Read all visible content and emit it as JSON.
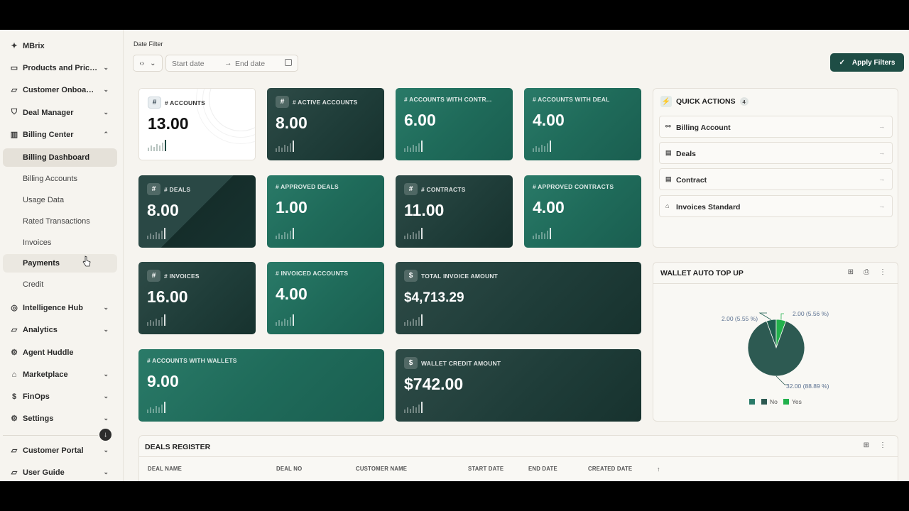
{
  "app": {
    "name": "MBrix"
  },
  "sidebar": {
    "items": [
      {
        "label": "MBrix",
        "icon": "sparkle-icon"
      },
      {
        "label": "Products and Pricing",
        "icon": "box-icon"
      },
      {
        "label": "Customer Onboarding",
        "icon": "folder-icon"
      },
      {
        "label": "Deal Manager",
        "icon": "handshake-icon"
      },
      {
        "label": "Billing Center",
        "icon": "chart-icon"
      },
      {
        "label": "Intelligence Hub",
        "icon": "globe-icon"
      },
      {
        "label": "Analytics",
        "icon": "folder-icon"
      },
      {
        "label": "Agent Huddle",
        "icon": "agent-icon"
      },
      {
        "label": "Marketplace",
        "icon": "store-icon"
      },
      {
        "label": "FinOps",
        "icon": "dollar-icon"
      },
      {
        "label": "Settings",
        "icon": "settings-icon"
      },
      {
        "label": "Customer Portal",
        "icon": "folder-icon"
      },
      {
        "label": "User Guide",
        "icon": "folder-icon"
      }
    ],
    "billing_sub": [
      "Billing Dashboard",
      "Billing Accounts",
      "Usage Data",
      "Rated Transactions",
      "Invoices",
      "Payments",
      "Credit"
    ]
  },
  "filter": {
    "title": "Date Filter",
    "start_placeholder": "Start date",
    "end_placeholder": "End date",
    "apply_label": "Apply Filters"
  },
  "kpis": [
    {
      "title": "# ACCOUNTS",
      "value": "13.00"
    },
    {
      "title": "# ACTIVE ACCOUNTS",
      "value": "8.00"
    },
    {
      "title": "# ACCOUNTS WITH CONTR...",
      "value": "6.00"
    },
    {
      "title": "# ACCOUNTS WITH DEAL",
      "value": "4.00"
    },
    {
      "title": "# DEALS",
      "value": "8.00"
    },
    {
      "title": "# APPROVED DEALS",
      "value": "1.00"
    },
    {
      "title": "# CONTRACTS",
      "value": "11.00"
    },
    {
      "title": "# APPROVED CONTRACTS",
      "value": "4.00"
    },
    {
      "title": "# INVOICES",
      "value": "16.00"
    },
    {
      "title": "# INVOICED ACCOUNTS",
      "value": "4.00"
    },
    {
      "title": "TOTAL INVOICE AMOUNT",
      "value": "$4,713.29"
    },
    {
      "title": "# ACCOUNTS WITH WALLETS",
      "value": "9.00"
    },
    {
      "title": "WALLET CREDIT AMOUNT",
      "value": "$742.00"
    }
  ],
  "quick_actions": {
    "title": "QUICK ACTIONS",
    "count": "4",
    "items": [
      "Billing Account",
      "Deals",
      "Contract",
      "Invoices Standard"
    ]
  },
  "wallet": {
    "title": "WALLET AUTO TOP UP",
    "labels": [
      "2.00 (5.55 %)",
      "2.00 (5.56 %)",
      "32.00 (88.89 %)"
    ],
    "legend": [
      "No",
      "Yes"
    ]
  },
  "chart_data": {
    "type": "pie",
    "title": "WALLET AUTO TOP UP",
    "slices": [
      {
        "value": 2.0,
        "percent": 5.55,
        "color": "#1e5e4f"
      },
      {
        "value": 2.0,
        "percent": 5.56,
        "color": "#22b14c"
      },
      {
        "value": 32.0,
        "percent": 88.89,
        "color": "#2d5a52"
      }
    ],
    "legend": [
      "No",
      "Yes"
    ],
    "legend_colors": [
      "#2a7a68",
      "#2d5a52",
      "#22b14c"
    ]
  },
  "deals_register": {
    "title": "DEALS REGISTER",
    "columns": [
      "DEAL NAME",
      "DEAL NO",
      "CUSTOMER NAME",
      "START DATE",
      "END DATE",
      "CREATED DATE"
    ]
  }
}
